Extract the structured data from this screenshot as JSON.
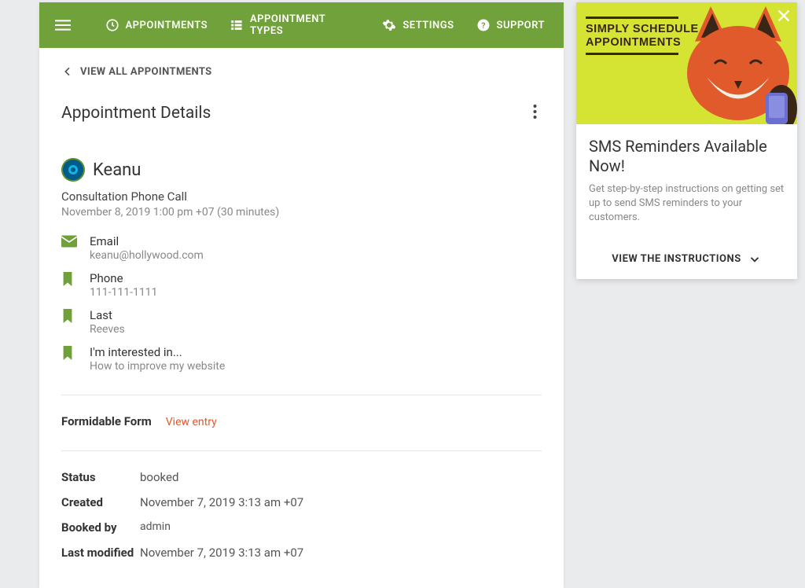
{
  "nav": {
    "appointments": "APPOINTMENTS",
    "appointment_types": "APPOINTMENT TYPES",
    "settings": "SETTINGS",
    "support": "SUPPORT"
  },
  "breadcrumb": "VIEW ALL APPOINTMENTS",
  "page_title": "Appointment Details",
  "customer": {
    "name": "Keanu",
    "type": "Consultation Phone Call",
    "time": "November 8, 2019 1:00 pm +07 (30 minutes)"
  },
  "fields": {
    "email": {
      "label": "Email",
      "value": "keanu@hollywood.com"
    },
    "phone": {
      "label": "Phone",
      "value": "111-111-1111"
    },
    "last": {
      "label": "Last",
      "value": "Reeves"
    },
    "interest": {
      "label": "I'm interested in...",
      "value": "How to improve my website"
    }
  },
  "form_section": {
    "title": "Formidable Form",
    "link": "View entry"
  },
  "meta": {
    "status": {
      "label": "Status",
      "value": "booked"
    },
    "created": {
      "label": "Created",
      "value": "November 7, 2019 3:13 am +07"
    },
    "booked_by": {
      "label": "Booked by",
      "value": "admin"
    },
    "last_modified": {
      "label": "Last modified",
      "value": "November 7, 2019 3:13 am +07"
    }
  },
  "promo": {
    "brand1": "SIMPLY SCHEDULE",
    "brand2": "APPOINTMENTS",
    "title": "SMS Reminders Available Now!",
    "desc": "Get step-by-step instructions on getting set up to send SMS reminders to your customers.",
    "action": "VIEW THE INSTRUCTIONS"
  }
}
